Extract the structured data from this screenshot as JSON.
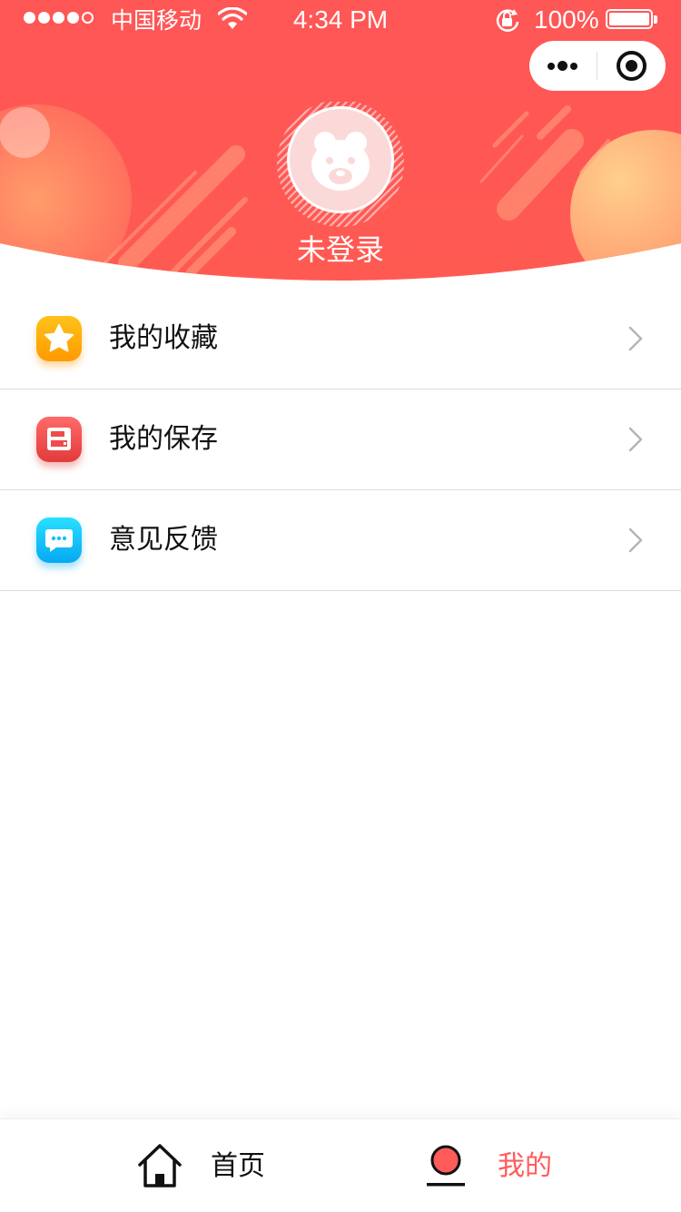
{
  "status_bar": {
    "carrier": "中国移动",
    "time": "4:34 PM",
    "battery": "100%",
    "signal_bars_filled": 4,
    "signal_bars_total": 5
  },
  "capsule": {
    "more_icon": "more-dots-icon",
    "close_icon": "target-close-icon"
  },
  "profile": {
    "avatar_icon": "bear-avatar-icon",
    "login_status": "未登录"
  },
  "menu": {
    "items": [
      {
        "label": "我的收藏",
        "icon": "star-icon"
      },
      {
        "label": "我的保存",
        "icon": "save-icon"
      },
      {
        "label": "意见反馈",
        "icon": "chat-bubble-icon"
      }
    ]
  },
  "tabbar": {
    "tabs": [
      {
        "label": "首页",
        "icon": "home-icon",
        "active": false
      },
      {
        "label": "我的",
        "icon": "user-icon",
        "active": true
      }
    ]
  },
  "colors": {
    "header": "#ff5656",
    "accent": "#ff5b5b",
    "star": "#ffb000",
    "save": "#ef4b4b",
    "chat": "#12c2f9"
  }
}
